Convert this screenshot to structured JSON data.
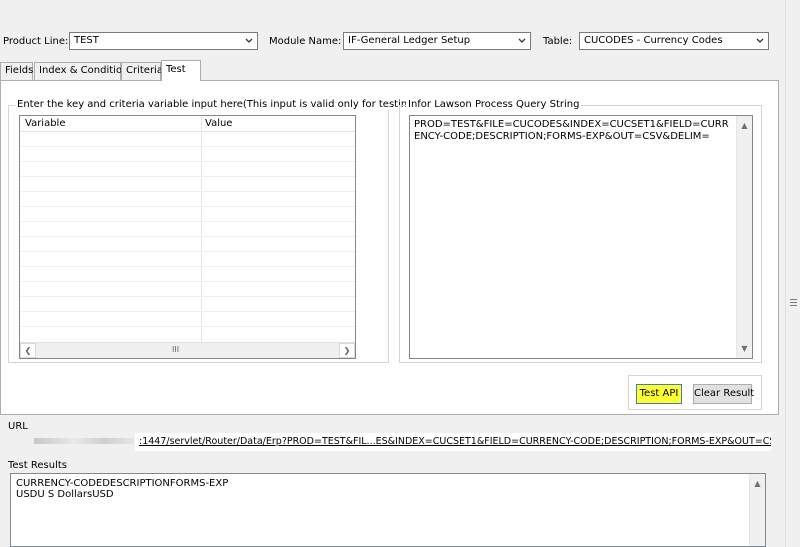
{
  "header": {
    "product_line_label": "Product Line:",
    "product_line_value": "TEST",
    "module_name_label": "Module Name:",
    "module_name_value": "IF-General Ledger Setup",
    "table_label": "Table:",
    "table_value": "CUCODES - Currency Codes"
  },
  "tabs": [
    {
      "label": "Fields",
      "active": false
    },
    {
      "label": "Index & Condition",
      "active": false
    },
    {
      "label": "Criteria",
      "active": false
    },
    {
      "label": "Test",
      "active": true
    }
  ],
  "variables_group": {
    "title": "Enter the key and criteria variable input here(This input is valid only for testing the API)",
    "columns": [
      "Variable",
      "Value"
    ],
    "rows": [],
    "scroll_thumb": "III"
  },
  "query_group": {
    "title": "Infor Lawson Process Query String",
    "text": "PROD=TEST&FILE=CUCODES&INDEX=CUCSET1&FIELD=CURRENCY-CODE;DESCRIPTION;FORMS-EXP&OUT=CSV&DELIM="
  },
  "buttons": {
    "test_api": "Test API",
    "clear_result": "Clear Result"
  },
  "url_section": {
    "label": "URL",
    "value": ":1447/servlet/Router/Data/Erp?PROD=TEST&FIL...ES&INDEX=CUCSET1&FIELD=CURRENCY-CODE;DESCRIPTION;FORMS-EXP&OUT=CSV&DELIM="
  },
  "results_section": {
    "label": "Test Results",
    "lines": [
      "CURRENCY-CODEDESCRIPTIONFORMS-EXP",
      "USDU S DollarsUSD"
    ]
  },
  "colors": {
    "highlight_button": "#ffff33",
    "panel_background": "#ffffff",
    "window_background": "#f0f0f0"
  }
}
